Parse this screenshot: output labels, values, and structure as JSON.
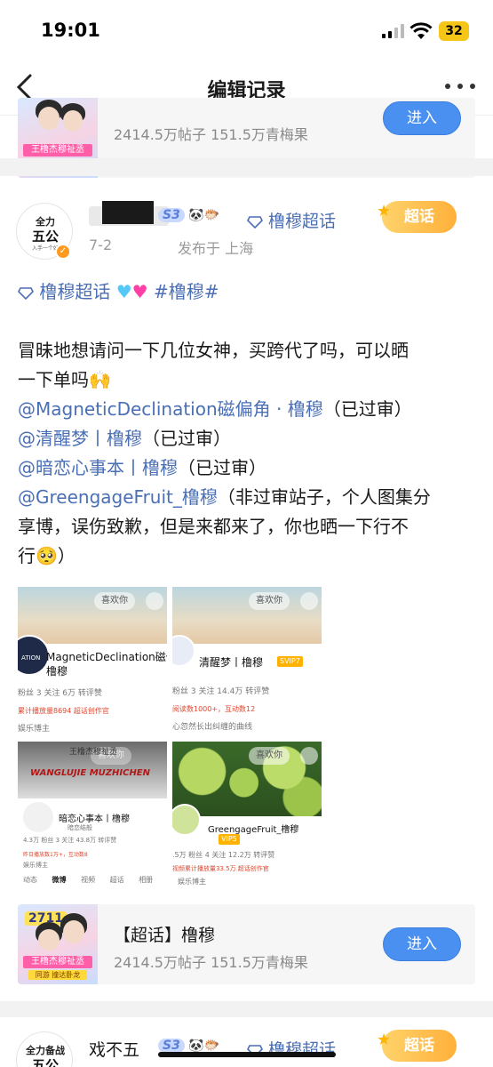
{
  "status_bar": {
    "time": "19:01",
    "battery": "32"
  },
  "nav": {
    "title": "编辑记录"
  },
  "topic_card": {
    "title": "【超话】橹穆",
    "stats": "2414.5万帖子 151.5万青梅果",
    "enter_label": "进入",
    "thumb_badge": "2711",
    "thumb_banner": "王橹杰穆祉丞",
    "thumb_sub": "同游 撞达卧龙"
  },
  "post": {
    "avatar_top": "全力",
    "avatar_mid": "五公",
    "avatar_bot": "入手一个好",
    "badge_text": "S3",
    "supertopic_name": "橹穆超话",
    "date": "7-2",
    "location": "发布于 上海",
    "tag": "超话",
    "topic_line": "橹穆超话",
    "hashtag": "#橹穆#",
    "body_intro_1": "冒昧地想请问一下几位女神，买跨代了吗，可以晒",
    "body_intro_2": "一下单吗🙌",
    "mention_1": "@MagneticDeclination磁偏角 · 橹穆",
    "mention_1_note": "（已过审）",
    "mention_2": "@清醒梦丨橹穆",
    "mention_2_note": "（已过审）",
    "mention_3": "@暗恋心事本丨橹穆",
    "mention_3_note": "（已过审）",
    "mention_4": "@GreengageFruit_橹穆",
    "mention_4_note": "（非过审站子，个人图集分",
    "body_tail_1": "享博，误伤致歉，但是来都来了，你也晒一下行不",
    "body_tail_2": "行🥺）"
  },
  "screenshots": [
    {
      "chip": "喜欢你",
      "name": "MagneticDeclination磁偏",
      "name2": "橹穆",
      "avatar_text": "ATION",
      "stats": "粉丝    3 关注    6万 转评赞",
      "red": "累计播放量8694    超话创作官",
      "small": "娱乐博主"
    },
    {
      "chip": "喜欢你",
      "name": "清醒梦丨橹穆",
      "vip": "SVIP7",
      "stats": "粉丝    3 关注    14.4万 转评赞",
      "red": "阅读数1000+，互动数12",
      "small": "心忽然长出纠缠的曲线"
    },
    {
      "chip": "喜欢你",
      "banner_title": "王橹杰穆祉丞",
      "banner_big": "WANGLUJIE MUZHICHEN",
      "name": "暗恋心事本丨橹穆",
      "name_sub": "暗恋结般",
      "stats": "4.3万 粉丝    3 关注    43.8万 转评赞",
      "red": "昨日播放数1万+，互动数8",
      "small": "娱乐博主",
      "tabs": [
        "动态",
        "微博",
        "视频",
        "超话",
        "相册"
      ]
    },
    {
      "chip": "喜欢你",
      "name": "GreengageFruit_橹穆",
      "vip": "VIP5",
      "stats": ".5万 粉丝    4 关注    12.2万 转评赞",
      "red": "视频累计播放量33.5万    超话创作官",
      "small": "娱乐博主"
    }
  ],
  "bottom_post": {
    "username": "戏不五",
    "avatar_top": "全力备战",
    "avatar_mid": "五公",
    "supertopic_name": "橹穆超话",
    "tag": "超话"
  },
  "colors": {
    "accent": "#4a90f0",
    "link": "#4a6fb5",
    "tag": "#ffb03a"
  }
}
